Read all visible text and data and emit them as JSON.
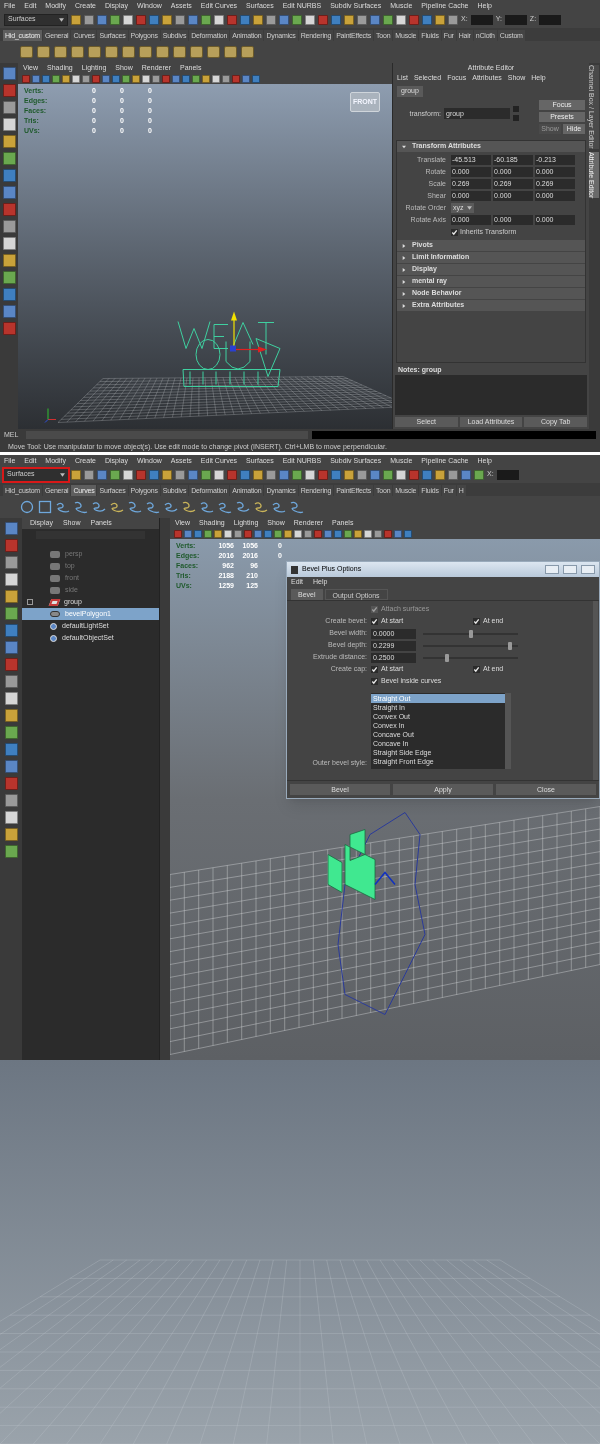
{
  "screenshot_1": {
    "menu_bar": [
      "File",
      "Edit",
      "Modify",
      "Create",
      "Display",
      "Window",
      "Assets",
      "Edit Curves",
      "Surfaces",
      "Edit NURBS",
      "Subdiv Surfaces",
      "Muscle",
      "Pipeline Cache",
      "Help"
    ],
    "menu_set": {
      "value": "Surfaces",
      "highlighted": false
    },
    "coord_fields": [
      "X:",
      "Y:",
      "Z:"
    ],
    "shelf_tabs": [
      {
        "label": "Hid_custom",
        "selected": true
      },
      {
        "label": "General",
        "selected": false
      },
      {
        "label": "Curves",
        "selected": false
      },
      {
        "label": "Surfaces",
        "selected": false
      },
      {
        "label": "Polygons",
        "selected": false
      },
      {
        "label": "Subdivs",
        "selected": false
      },
      {
        "label": "Deformation",
        "selected": false
      },
      {
        "label": "Animation",
        "selected": false
      },
      {
        "label": "Dynamics",
        "selected": false
      },
      {
        "label": "Rendering",
        "selected": false
      },
      {
        "label": "PaintEffects",
        "selected": false
      },
      {
        "label": "Toon",
        "selected": false
      },
      {
        "label": "Muscle",
        "selected": false
      },
      {
        "label": "Fluids",
        "selected": false
      },
      {
        "label": "Fur",
        "selected": false
      },
      {
        "label": "Hair",
        "selected": false
      },
      {
        "label": "nCloth",
        "selected": false
      },
      {
        "label": "Custom",
        "selected": false
      }
    ],
    "viewport": {
      "menu": [
        "View",
        "Shading",
        "Lighting",
        "Show",
        "Renderer",
        "Panels"
      ],
      "hud": [
        {
          "label": "Verts:",
          "values": [
            "0",
            "0",
            "0"
          ]
        },
        {
          "label": "Edges:",
          "values": [
            "0",
            "0",
            "0"
          ]
        },
        {
          "label": "Faces:",
          "values": [
            "0",
            "0",
            "0"
          ]
        },
        {
          "label": "Tris:",
          "values": [
            "0",
            "0",
            "0"
          ]
        },
        {
          "label": "UVs:",
          "values": [
            "0",
            "0",
            "0"
          ]
        }
      ],
      "view_cube": "FRONT"
    },
    "attribute_editor": {
      "title": "Attribute Editor",
      "menu": [
        "List",
        "Selected",
        "Focus",
        "Attributes",
        "Show",
        "Help"
      ],
      "node_tab": "group",
      "transform_label": "transform:",
      "transform_value": "group",
      "buttons": [
        {
          "label": "Focus",
          "disabled": false
        },
        {
          "label": "Presets",
          "disabled": false
        },
        {
          "label": "Show",
          "disabled": true
        },
        {
          "label": "Hide",
          "disabled": false
        }
      ],
      "sections": [
        {
          "title": "Transform Attributes",
          "expanded": true,
          "rows": [
            {
              "kind": "vector",
              "label": "Translate",
              "values": [
                "-45.513",
                "-60.185",
                "-0.213"
              ]
            },
            {
              "kind": "vector",
              "label": "Rotate",
              "values": [
                "0.000",
                "0.000",
                "0.000"
              ]
            },
            {
              "kind": "vector",
              "label": "Scale",
              "values": [
                "0.269",
                "0.269",
                "0.269"
              ]
            },
            {
              "kind": "vector",
              "label": "Shear",
              "values": [
                "0.000",
                "0.000",
                "0.000"
              ]
            },
            {
              "kind": "dropdown",
              "label": "Rotate Order",
              "value": "xyz"
            },
            {
              "kind": "vector",
              "label": "Rotate Axis",
              "values": [
                "0.000",
                "0.000",
                "0.000"
              ]
            },
            {
              "kind": "checkbox",
              "label": "Inherits Transform",
              "checked": true
            }
          ]
        },
        {
          "title": "Pivots",
          "expanded": false
        },
        {
          "title": "Limit Information",
          "expanded": false
        },
        {
          "title": "Display",
          "expanded": false
        },
        {
          "title": "mental ray",
          "expanded": false
        },
        {
          "title": "Node Behavior",
          "expanded": false
        },
        {
          "title": "Extra Attributes",
          "expanded": false
        }
      ],
      "notes_label": "Notes: group",
      "bottom_buttons": [
        "Select",
        "Load Attributes",
        "Copy Tab"
      ]
    },
    "side_tabs": [
      {
        "label": "Channel Box / Layer Editor",
        "selected": false
      },
      {
        "label": "Attribute Editor",
        "selected": true
      }
    ],
    "command_line": {
      "label": "MEL"
    },
    "help_line": "Move Tool: Use manipulator to move object(s). Use edit mode to change pivot (INSERT). Ctrl+LMB to move perpendicular."
  },
  "screenshot_2": {
    "menu_bar": [
      "File",
      "Edit",
      "Modify",
      "Create",
      "Display",
      "Window",
      "Assets",
      "Edit Curves",
      "Surfaces",
      "Edit NURBS",
      "Subdiv Surfaces",
      "Muscle",
      "Pipeline Cache",
      "Help"
    ],
    "menu_set": {
      "value": "Surfaces",
      "highlighted": true
    },
    "coord_fields": [
      "X:"
    ],
    "shelf_tabs": [
      {
        "label": "Hid_custom",
        "selected": false
      },
      {
        "label": "General",
        "selected": false
      },
      {
        "label": "Curves",
        "selected": true
      },
      {
        "label": "Surfaces",
        "selected": false
      },
      {
        "label": "Polygons",
        "selected": false
      },
      {
        "label": "Subdivs",
        "selected": false
      },
      {
        "label": "Deformation",
        "selected": false
      },
      {
        "label": "Animation",
        "selected": false
      },
      {
        "label": "Dynamics",
        "selected": false
      },
      {
        "label": "Rendering",
        "selected": false
      },
      {
        "label": "PaintEffects",
        "selected": false
      },
      {
        "label": "Toon",
        "selected": false
      },
      {
        "label": "Muscle",
        "selected": false
      },
      {
        "label": "Fluids",
        "selected": false
      },
      {
        "label": "Fur",
        "selected": false
      },
      {
        "label": "H",
        "selected": false
      }
    ],
    "outliner": {
      "menu": [
        "Display",
        "Show",
        "Panels"
      ],
      "items": [
        {
          "kind": "camera",
          "label": "persp",
          "dimmed": true,
          "selected": false
        },
        {
          "kind": "camera",
          "label": "top",
          "dimmed": true,
          "selected": false
        },
        {
          "kind": "camera",
          "label": "front",
          "dimmed": true,
          "selected": false
        },
        {
          "kind": "camera",
          "label": "side",
          "dimmed": true,
          "selected": false
        },
        {
          "kind": "group",
          "label": "group",
          "dimmed": false,
          "selected": false
        },
        {
          "kind": "mesh",
          "label": "bevelPolygon1",
          "dimmed": false,
          "selected": true
        },
        {
          "kind": "set",
          "label": "defaultLightSet",
          "dimmed": false,
          "selected": false
        },
        {
          "kind": "set",
          "label": "defaultObjectSet",
          "dimmed": false,
          "selected": false
        }
      ]
    },
    "viewport": {
      "menu": [
        "View",
        "Shading",
        "Lighting",
        "Show",
        "Renderer",
        "Panels"
      ],
      "hud": [
        {
          "label": "Verts:",
          "values": [
            "1056",
            "1056",
            "0"
          ]
        },
        {
          "label": "Edges:",
          "values": [
            "2016",
            "2016",
            "0"
          ]
        },
        {
          "label": "Faces:",
          "values": [
            "962",
            "96"
          ]
        },
        {
          "label": "Tris:",
          "values": [
            "2188",
            "210"
          ]
        },
        {
          "label": "UVs:",
          "values": [
            "1259",
            "125"
          ]
        }
      ]
    },
    "dialog": {
      "title": "Bevel Plus Options",
      "menu": [
        "Edit",
        "Help"
      ],
      "tabs": [
        {
          "label": "Bevel",
          "selected": true
        },
        {
          "label": "Output Options",
          "selected": false
        }
      ],
      "rows": [
        {
          "kind": "checks",
          "options": [
            {
              "label": "Attach surfaces",
              "checked": true,
              "disabled": true
            }
          ]
        },
        {
          "kind": "checks",
          "label": "Create bevel:",
          "options": [
            {
              "label": "At start",
              "checked": true,
              "disabled": false
            },
            {
              "label": "At end",
              "checked": true,
              "disabled": false
            }
          ]
        },
        {
          "kind": "slider",
          "label": "Bevel width:",
          "value": "0.0000",
          "level": 0.5
        },
        {
          "kind": "slider",
          "label": "Bevel depth:",
          "value": "0.2299",
          "level": 0.92
        },
        {
          "kind": "slider",
          "label": "Extrude distance:",
          "value": "0.2500",
          "level": 0.25
        },
        {
          "kind": "checks",
          "label": "Create cap:",
          "options": [
            {
              "label": "At start",
              "checked": true,
              "disabled": false
            },
            {
              "label": "At end",
              "checked": true,
              "disabled": false
            }
          ]
        },
        {
          "kind": "checks",
          "options": [
            {
              "label": "Bevel inside curves",
              "checked": true,
              "disabled": false
            }
          ]
        },
        {
          "kind": "list",
          "label": "Outer bevel style:",
          "items": [
            {
              "label": "Straight Out",
              "selected": true
            },
            {
              "label": "Straight In",
              "selected": false
            },
            {
              "label": "Convex Out",
              "selected": false
            },
            {
              "label": "Convex In",
              "selected": false
            },
            {
              "label": "Concave Out",
              "selected": false
            },
            {
              "label": "Concave In",
              "selected": false
            },
            {
              "label": "Straight Side Edge",
              "selected": false
            },
            {
              "label": "Straight Front Edge",
              "selected": false
            }
          ]
        }
      ],
      "buttons": [
        "Bevel",
        "Apply",
        "Close"
      ]
    }
  }
}
